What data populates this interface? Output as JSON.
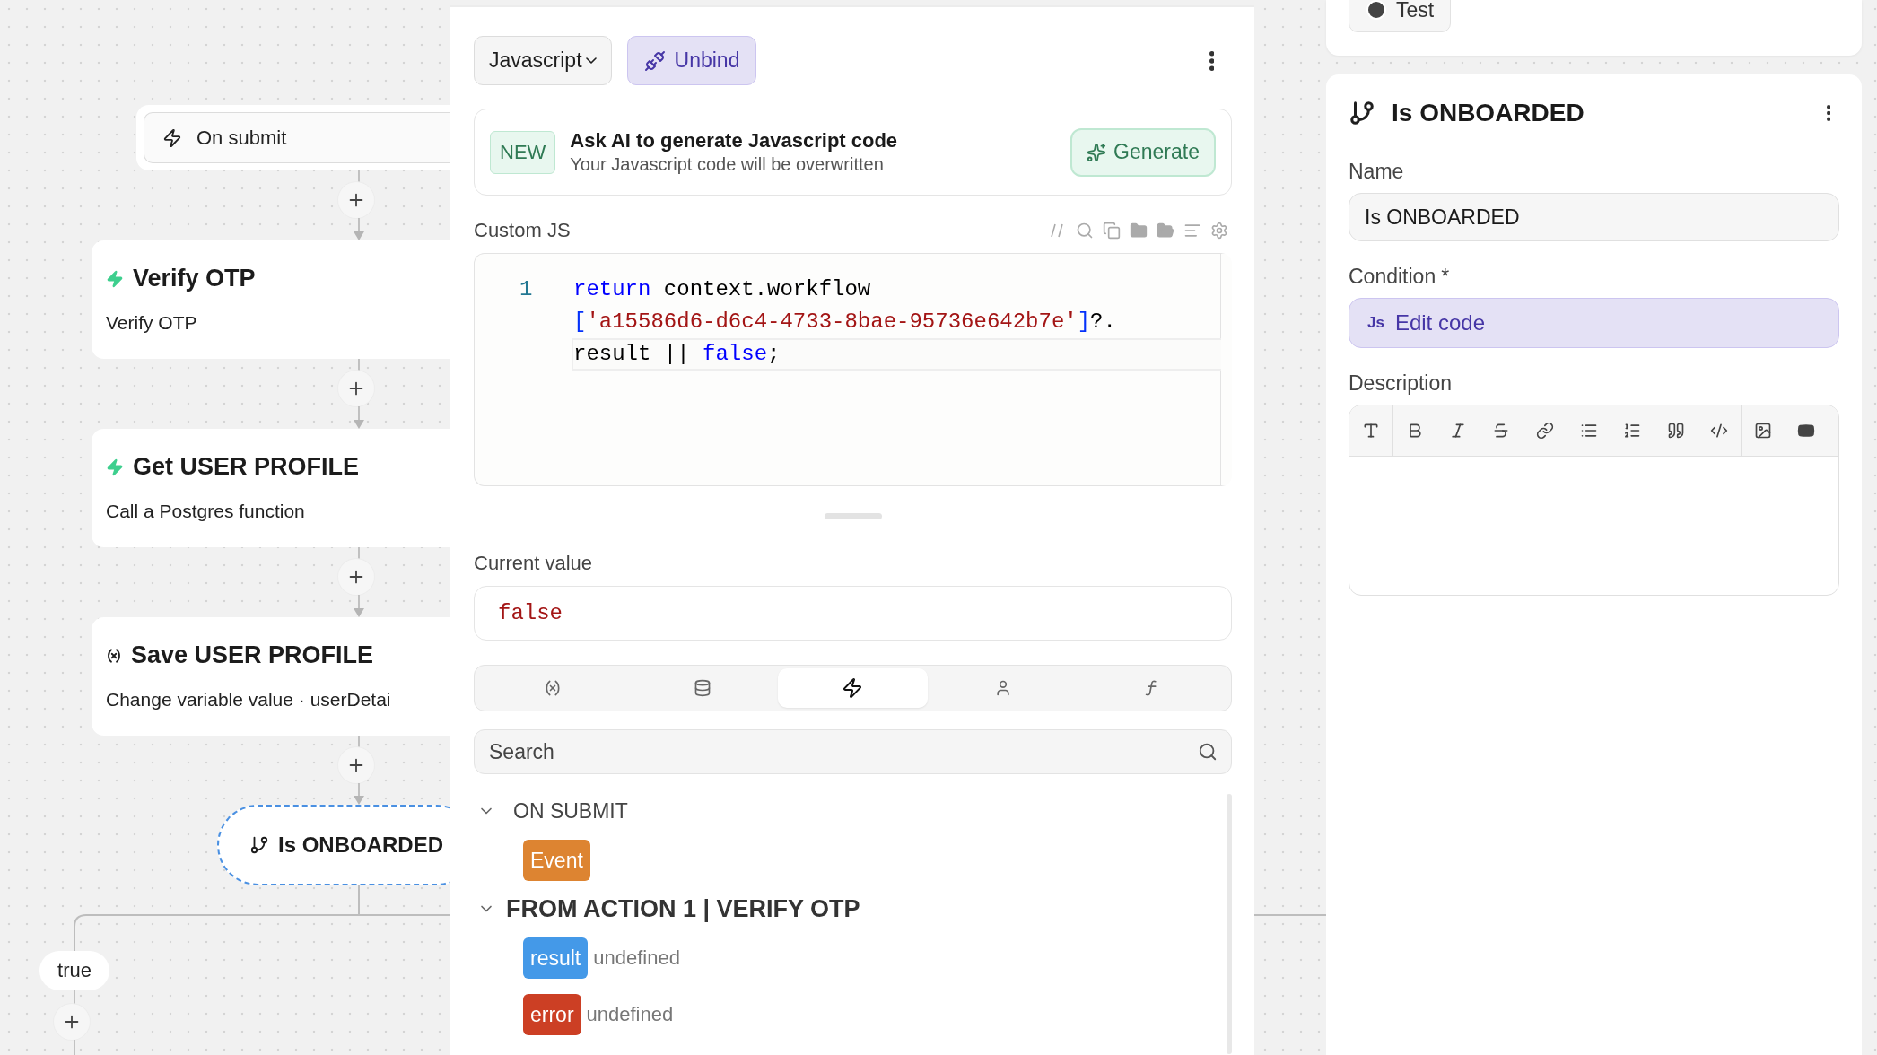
{
  "canvas": {
    "trigger": {
      "label": "On submit"
    },
    "nodes": [
      {
        "kind": "action",
        "title": "Verify OTP",
        "subtitle": "Verify OTP"
      },
      {
        "kind": "action",
        "title": "Get USER PROFILE",
        "subtitle": "Call a Postgres function"
      },
      {
        "kind": "variable",
        "title": "Save USER PROFILE",
        "subtitle": "Change variable value · userDetai"
      }
    ],
    "branch": {
      "label": "Is ONBOARDED",
      "selected": true
    },
    "branch_labels": [
      {
        "label": "true"
      }
    ]
  },
  "editor": {
    "language": "Javascript",
    "unbind": "Unbind",
    "ai": {
      "badge": "NEW",
      "title": "Ask AI to generate Javascript code",
      "subtitle": "Your Javascript code will be overwritten",
      "button": "Generate"
    },
    "code_label": "Custom JS",
    "code_rows": [
      {
        "line_number": "1",
        "active": false,
        "tokens": [
          {
            "kind": "keyword",
            "text": "return"
          },
          {
            "kind": "plain",
            "text": " context.workflow"
          }
        ]
      },
      {
        "active": false,
        "tokens": [
          {
            "kind": "bracket",
            "text": "["
          },
          {
            "kind": "string",
            "text": "'a15586d6-d6c4-4733-8bae-95736e642b7e'"
          },
          {
            "kind": "bracket",
            "text": "]"
          },
          {
            "kind": "plain",
            "text": "?."
          }
        ]
      },
      {
        "active": true,
        "tokens": [
          {
            "kind": "plain",
            "text": "result || "
          },
          {
            "kind": "keyword",
            "text": "false"
          },
          {
            "kind": "plain",
            "text": ";"
          }
        ]
      }
    ],
    "current_value_label": "Current value",
    "current_value": "false",
    "tabs": [
      {
        "kind": "variables",
        "selected": false
      },
      {
        "kind": "data",
        "selected": false
      },
      {
        "kind": "workflow",
        "selected": true
      },
      {
        "kind": "user",
        "selected": false
      },
      {
        "kind": "functions",
        "selected": false
      }
    ],
    "search": {
      "placeholder": "Search"
    },
    "groups": [
      {
        "title": "ON SUBMIT",
        "expanded": true,
        "hovered": false,
        "children": [
          {
            "label": "Event",
            "color": "#dd8431"
          }
        ]
      },
      {
        "title": "FROM ACTION 1 | VERIFY OTP",
        "expanded": true,
        "hovered": true,
        "children": [
          {
            "label": "result",
            "value": "undefined",
            "color": "#4499e8"
          },
          {
            "label": "error",
            "value": "undefined",
            "color": "#cc3f24"
          }
        ]
      }
    ]
  },
  "inspector": {
    "test_button": "Test",
    "title": "Is ONBOARDED",
    "name_label": "Name",
    "name_value": "Is ONBOARDED",
    "condition_label": "Condition",
    "required_mark": "*",
    "condition_badge": "Js",
    "condition_button": "Edit code",
    "description_label": "Description"
  }
}
